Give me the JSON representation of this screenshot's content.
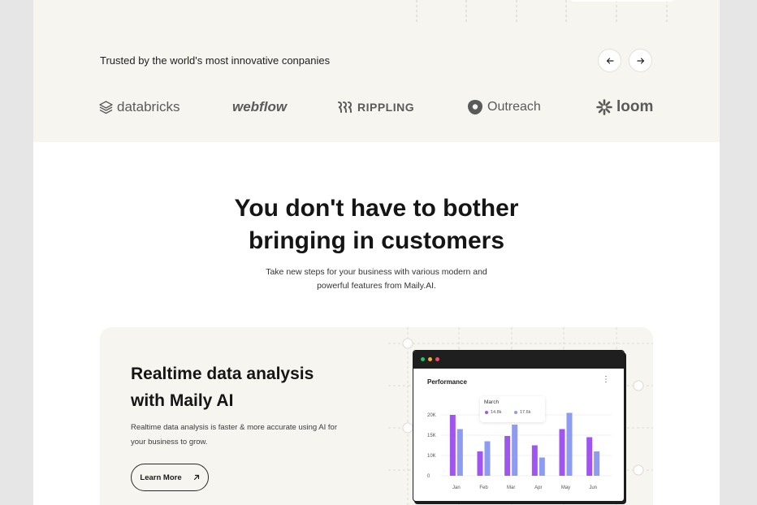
{
  "trusted": {
    "title": "Trusted by the world's most innovative conpanies",
    "prev_icon": "arrow-left-icon",
    "next_icon": "arrow-right-icon",
    "logos": [
      {
        "name": "databricks",
        "icon": "databricks-logo-icon"
      },
      {
        "name": "webflow",
        "icon": "none"
      },
      {
        "name": "RIPPLING",
        "icon": "rippling-logo-icon"
      },
      {
        "name": "Outreach",
        "icon": "outreach-logo-icon"
      },
      {
        "name": "loom",
        "icon": "loom-logo-icon"
      }
    ]
  },
  "hero": {
    "headline_line1": "You don't have to bother",
    "headline_line2": "bringing in customers",
    "sub_line1": "Take new steps for your business with various modern and",
    "sub_line2": "powerful features from Maily.AI."
  },
  "feature": {
    "title_line1": "Realtime data analysis",
    "title_line2": "with Maily AI",
    "desc_line1": "Realtime data analysis is faster & more accurate using AI for",
    "desc_line2": "your business to grow.",
    "cta_label": "Learn More",
    "cta_icon": "arrow-up-right-icon"
  },
  "dashboard": {
    "title": "Performance",
    "menu_icon": "kebab-menu-icon",
    "window_dots": [
      "#27c26c",
      "#f0b429",
      "#ef4f6b"
    ],
    "tooltip": {
      "month": "March",
      "a_label": "14.8k",
      "b_label": "17.6k"
    }
  },
  "colors": {
    "page_bg": "#f7f5f0",
    "series_a": "#a155f0",
    "series_b": "#8d9cf0"
  },
  "chart_data": {
    "type": "bar",
    "categories": [
      "Jan",
      "Feb",
      "Mar",
      "Apr",
      "May",
      "Jun"
    ],
    "series": [
      {
        "values": [
          20000,
          11000,
          14800,
          12500,
          16500,
          14500
        ]
      },
      {
        "values": [
          16500,
          13500,
          17600,
          9500,
          20500,
          11000
        ]
      }
    ],
    "yticks": [
      "0",
      "10K",
      "15K",
      "20K"
    ],
    "ylim": [
      5000,
      22000
    ],
    "grid": true
  }
}
